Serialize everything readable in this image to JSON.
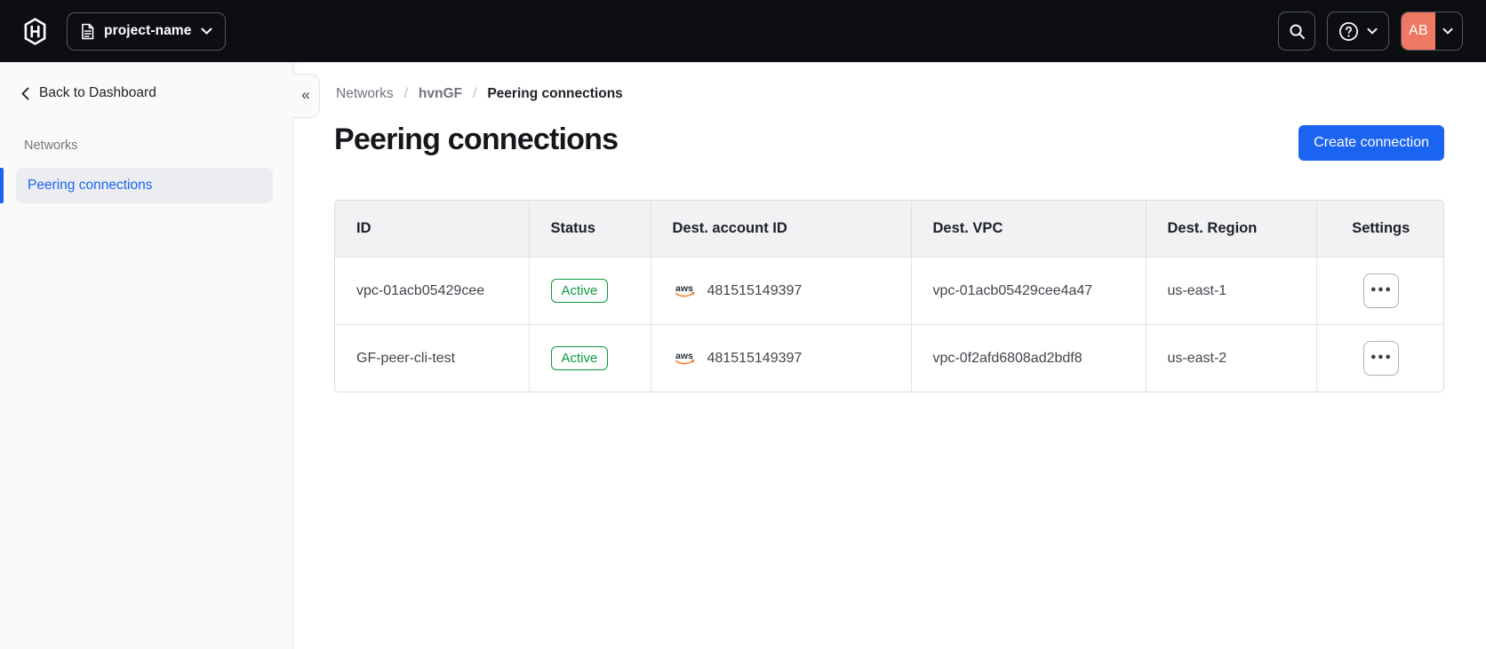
{
  "colors": {
    "topbar_bg": "#0c0e12",
    "accent": "#1b64f2",
    "success": "#0a9a3c",
    "avatar_bg": "#ee7862"
  },
  "topbar": {
    "project_switcher": {
      "label": "project-name"
    },
    "avatar": {
      "initials": "AB"
    }
  },
  "sidebar": {
    "back_label": "Back to Dashboard",
    "section_label": "Networks",
    "items": [
      {
        "label": "Peering connections",
        "active": true
      }
    ],
    "collapse_icon": "«"
  },
  "breadcrumb": {
    "separator": "/",
    "items": [
      {
        "label": "Networks"
      },
      {
        "label": "hvnGF"
      },
      {
        "label": "Peering connections"
      }
    ]
  },
  "page": {
    "title": "Peering connections",
    "create_button_label": "Create connection"
  },
  "table": {
    "columns": {
      "id": "ID",
      "status": "Status",
      "dest_account_id": "Dest. account ID",
      "dest_vpc": "Dest. VPC",
      "dest_region": "Dest. Region",
      "settings": "Settings"
    },
    "rows": [
      {
        "id": "vpc-01acb05429cee",
        "status": "Active",
        "dest_account_provider": "aws",
        "dest_account_id": "481515149397",
        "dest_vpc": "vpc-01acb05429cee4a47",
        "dest_region": "us-east-1",
        "settings_icon": "●●●"
      },
      {
        "id": "GF-peer-cli-test",
        "status": "Active",
        "dest_account_provider": "aws",
        "dest_account_id": "481515149397",
        "dest_vpc": "vpc-0f2afd6808ad2bdf8",
        "dest_region": "us-east-2",
        "settings_icon": "●●●"
      }
    ]
  }
}
